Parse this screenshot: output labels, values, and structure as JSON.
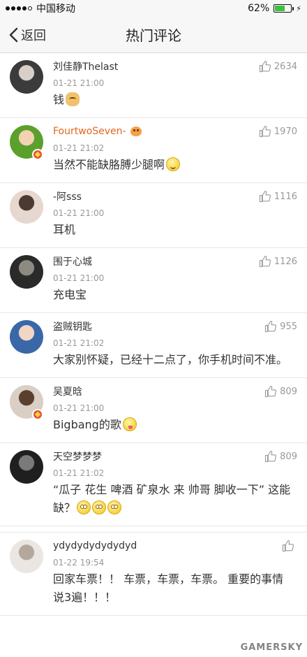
{
  "status_bar": {
    "carrier": "中国移动",
    "battery_percent": "62%",
    "battery_level": 0.62,
    "signal_bars_filled": 4,
    "signal_bars_total": 5,
    "battery_color": "#3ec13e"
  },
  "nav": {
    "back_label": "返回",
    "title": "热门评论"
  },
  "comments": [
    {
      "username": "刘佳静Thelast",
      "time": "01-21 21:00",
      "likes": "2634",
      "text": "钱",
      "emoji": "dog"
    },
    {
      "username": "FourtwoSeven-",
      "time": "01-21 21:02",
      "likes": "1970",
      "text": "当然不能缺胳膊少腿啊",
      "emoji": "smile"
    },
    {
      "username": "-阿sss",
      "time": "01-21 21:00",
      "likes": "1116",
      "text": "耳机"
    },
    {
      "username": "围于心城",
      "time": "01-21 21:00",
      "likes": "1126",
      "text": "充电宝"
    },
    {
      "username": "盗贼钥匙",
      "time": "01-21 21:02",
      "likes": "955",
      "text": "大家别怀疑，已经十二点了，你手机时间不准。"
    },
    {
      "username": "吴夏晗",
      "time": "01-21 21:00",
      "likes": "809",
      "text": "Bigbang的歌",
      "emoji": "tongue"
    },
    {
      "username": "天空梦梦梦",
      "time": "01-21 21:02",
      "likes": "809",
      "text": "“瓜子 花生 啤酒 矿泉水 来 帅哥 脚收一下” 这能缺？",
      "emoji": "flush"
    },
    {
      "username": "ydydydydydydyd",
      "time": "01-22 19:54",
      "likes": "",
      "text": "回家车票！！ 车票，车票，车票。 重要的事情说3遍！！！"
    }
  ],
  "watermark": "GAMERSKY",
  "icons": {
    "back": "chevron-left-icon",
    "like": "thumbs-up-icon"
  }
}
